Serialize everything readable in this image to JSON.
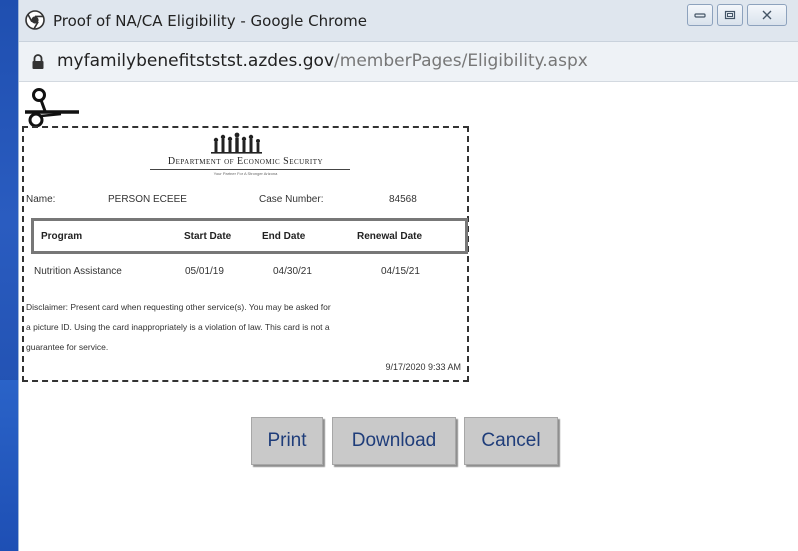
{
  "window": {
    "title": "Proof of NA/CA Eligibility - Google Chrome",
    "controls": [
      "minimize-icon",
      "maximize-icon",
      "close-icon"
    ]
  },
  "address_bar": {
    "domain": "myfamilybenefitststst.azdes.gov",
    "path": "/memberPages/Eligibility.aspx"
  },
  "card": {
    "agency_name": "Department of Economic Security",
    "agency_tagline": "Your Partner For A Stronger Arizona",
    "name_label": "Name:",
    "name_value": "PERSON ECEEE",
    "case_label": "Case Number:",
    "case_value": "84568",
    "table": {
      "headers": [
        "Program",
        "Start Date",
        "End Date",
        "Renewal Date"
      ],
      "rows": [
        [
          "Nutrition Assistance",
          "05/01/19",
          "04/30/21",
          "04/15/21"
        ]
      ]
    },
    "disclaimer_lines": [
      "Disclaimer: Present card when requesting other service(s). You may be asked for",
      "a picture ID. Using the card inappropriately is a violation of law. This card is not a",
      "guarantee for service."
    ],
    "timestamp": "9/17/2020 9:33 AM"
  },
  "actions": {
    "print": "Print",
    "download": "Download",
    "cancel": "Cancel"
  },
  "colors": {
    "desktop": "#1f4fb0",
    "button_bg": "#c9c9c9",
    "button_text": "#1f3d7a"
  }
}
